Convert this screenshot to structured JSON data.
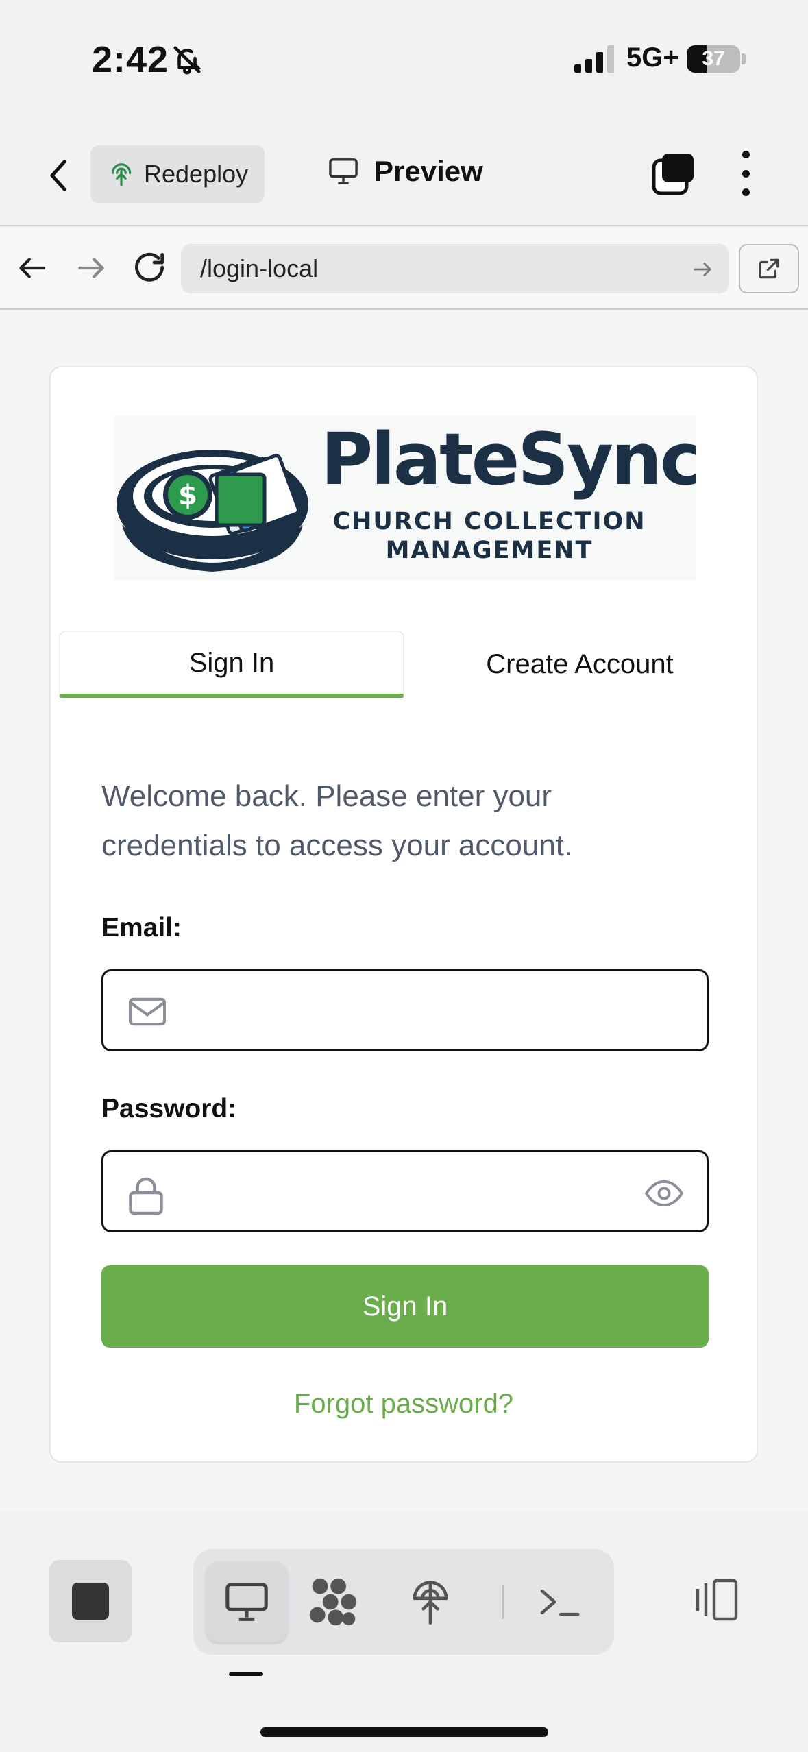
{
  "status_bar": {
    "time": "2:42",
    "network": "5G+",
    "battery": "37",
    "battery_fraction": 0.37,
    "signal_bars": 3
  },
  "app_toolbar": {
    "redeploy_label": "Redeploy",
    "preview_label": "Preview"
  },
  "browser": {
    "url": "/login-local"
  },
  "login": {
    "logo_title": "PlateSync",
    "logo_subtitle_1": "CHURCH COLLECTION",
    "logo_subtitle_2": "MANAGEMENT",
    "tab_signin": "Sign In",
    "tab_create": "Create Account",
    "welcome": "Welcome back. Please enter your credentials to access your account.",
    "email_label": "Email:",
    "email_value": "",
    "password_label": "Password:",
    "password_value": "",
    "submit_label": "Sign In",
    "forgot_label": "Forgot password?"
  },
  "colors": {
    "accent": "#6aad4b",
    "logo_navy": "#1b2f45",
    "logo_green": "#2e9a4d",
    "welcome_text": "#4f5b6b"
  },
  "bottom_toolbar": {
    "items": [
      "stop-icon",
      "desktop-icon",
      "network-graph-icon",
      "deploy-icon",
      "terminal-icon",
      "split-view-icon"
    ],
    "active": "desktop-icon"
  }
}
